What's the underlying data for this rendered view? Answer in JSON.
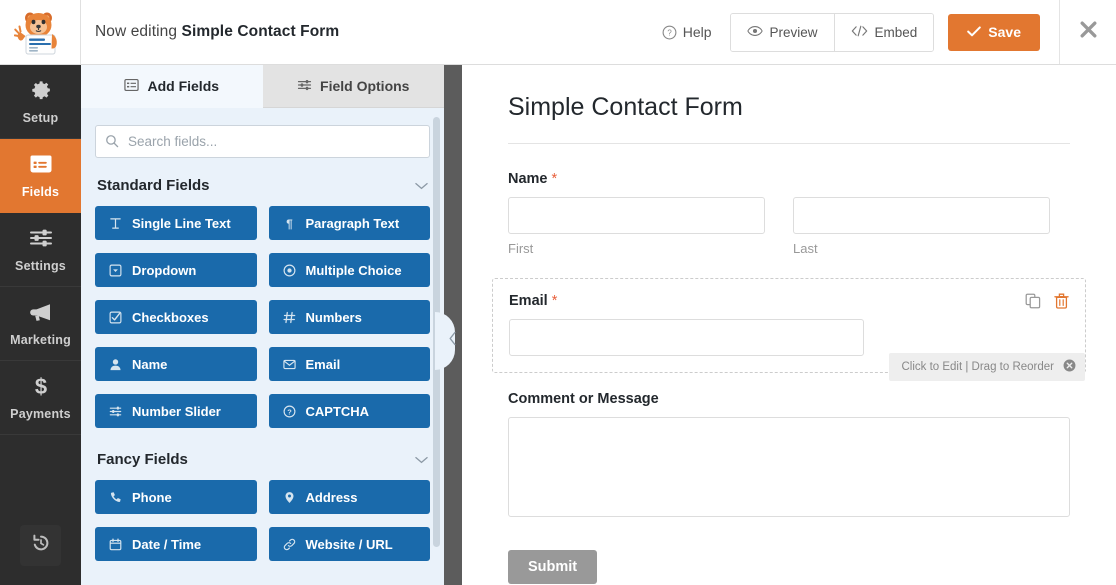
{
  "topbar": {
    "logo_icon": "wpforms-mascot-logo",
    "editing_prefix": "Now editing ",
    "form_name": "Simple Contact Form",
    "help_label": "Help",
    "help_icon": "question-circle-icon",
    "preview_label": "Preview",
    "preview_icon": "eye-icon",
    "embed_label": "Embed",
    "embed_icon": "code-brackets-icon",
    "save_label": "Save",
    "save_icon": "check-icon",
    "close_icon": "close-x-icon",
    "accent_orange": "#e27730"
  },
  "sidebar": {
    "items": [
      {
        "label": "Setup",
        "icon": "gear-icon",
        "active": false
      },
      {
        "label": "Fields",
        "icon": "form-icon",
        "active": true
      },
      {
        "label": "Settings",
        "icon": "sliders-icon",
        "active": false
      },
      {
        "label": "Marketing",
        "icon": "megaphone-icon",
        "active": false
      },
      {
        "label": "Payments",
        "icon": "dollar-icon",
        "active": false
      }
    ],
    "history_icon": "revision-history-icon",
    "active_color": "#e27730",
    "background": "#2d2d2d"
  },
  "panel": {
    "tabs": [
      {
        "label": "Add Fields",
        "icon": "fields-list-icon",
        "active": true
      },
      {
        "label": "Field Options",
        "icon": "field-options-icon",
        "active": false
      }
    ],
    "search": {
      "placeholder": "Search fields...",
      "value": "",
      "icon": "search-icon"
    },
    "sections": [
      {
        "title": "Standard Fields",
        "chevron_icon": "chevron-down-icon",
        "fields": [
          {
            "label": "Single Line Text",
            "icon": "text-cursor-icon"
          },
          {
            "label": "Paragraph Text",
            "icon": "pilcrow-icon"
          },
          {
            "label": "Dropdown",
            "icon": "caret-square-down-icon"
          },
          {
            "label": "Multiple Choice",
            "icon": "radio-circle-icon"
          },
          {
            "label": "Checkboxes",
            "icon": "checkbox-icon"
          },
          {
            "label": "Numbers",
            "icon": "hash-icon"
          },
          {
            "label": "Name",
            "icon": "user-icon"
          },
          {
            "label": "Email",
            "icon": "envelope-icon"
          },
          {
            "label": "Number Slider",
            "icon": "sliders-icon"
          },
          {
            "label": "CAPTCHA",
            "icon": "question-circle-icon"
          }
        ]
      },
      {
        "title": "Fancy Fields",
        "chevron_icon": "chevron-down-icon",
        "fields": [
          {
            "label": "Phone",
            "icon": "phone-icon"
          },
          {
            "label": "Address",
            "icon": "map-pin-icon"
          },
          {
            "label": "Date / Time",
            "icon": "calendar-icon"
          },
          {
            "label": "Website / URL",
            "icon": "link-icon"
          }
        ]
      }
    ],
    "field_button_color": "#1a6aab",
    "background": "#eaf2fa"
  },
  "divider": {
    "collapse_icon": "chevron-left-icon"
  },
  "form": {
    "title": "Simple Contact Form",
    "fields": [
      {
        "label": "Name",
        "required": true,
        "type": "name",
        "hovered": false,
        "columns": [
          {
            "value": "",
            "sublabel": "First"
          },
          {
            "value": "",
            "sublabel": "Last"
          }
        ]
      },
      {
        "label": "Email",
        "required": true,
        "type": "email",
        "hovered": true,
        "value": "",
        "tools": [
          {
            "name": "duplicate-icon",
            "title": "Duplicate"
          },
          {
            "name": "trash-icon",
            "title": "Delete"
          }
        ],
        "hint": "Click to Edit | Drag to Reorder",
        "hint_close_icon": "close-circle-icon"
      },
      {
        "label": "Comment or Message",
        "required": false,
        "type": "textarea",
        "hovered": false,
        "value": ""
      }
    ],
    "submit_label": "Submit",
    "required_marker": "*",
    "required_color": "#e8603c"
  }
}
